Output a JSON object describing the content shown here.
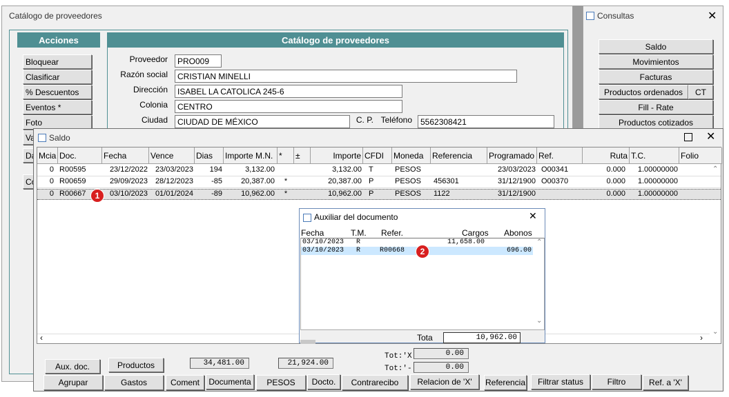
{
  "catalog": {
    "window_title": "Catálogo de proveedores",
    "acciones_header": "Acciones",
    "panel_header": "Catálogo de proveedores",
    "actions": [
      "Bloquear",
      "Clasificar",
      "% Descuentos",
      "Eventos *",
      "Foto",
      "Va",
      "Da",
      "Co"
    ],
    "fields": {
      "proveedor_label": "Proveedor",
      "proveedor": "PRO009",
      "razon_label": "Razón social",
      "razon": "CRISTIAN MINELLI",
      "direccion_label": "Dirección",
      "direccion": "ISABEL LA CATOLICA 245-6",
      "colonia_label": "Colonia",
      "colonia": "CENTRO",
      "ciudad_label": "Ciudad",
      "ciudad": "CIUDAD DE MÉXICO",
      "cp_label": "C. P.",
      "telefono_label": "Teléfono",
      "telefono": "5562308421"
    }
  },
  "consultas": {
    "title": "Consultas",
    "buttons": [
      "Saldo",
      "Movimientos",
      "Facturas",
      "Productos ordenados",
      "CT",
      "Fill - Rate",
      "Productos cotizados"
    ]
  },
  "saldo": {
    "title": "Saldo",
    "columns": [
      "Mcia",
      "Doc.",
      "Fecha",
      "Vence",
      "Dias",
      "Importe M.N.",
      "*",
      "±",
      "Importe",
      "CFDI",
      "Moneda",
      "Referencia",
      "Programado",
      "Ref.",
      "Ruta",
      "T.C.",
      "Folio"
    ],
    "rows": [
      [
        "0",
        "R00595",
        "23/12/2022",
        "23/03/2023",
        "194",
        "3,132.00",
        "",
        "",
        "3,132.00",
        "T",
        "PESOS",
        "",
        "23/03/2023",
        "O00341",
        "0.000",
        "1.00000000",
        ""
      ],
      [
        "0",
        "R00659",
        "29/09/2023",
        "28/12/2023",
        "-85",
        "20,387.00",
        "*",
        "",
        "20,387.00",
        "P",
        "PESOS",
        "456301",
        "31/12/1900",
        "O00370",
        "0.000",
        "1.00000000",
        ""
      ],
      [
        "0",
        "R00667",
        "03/10/2023",
        "01/01/2024",
        "-89",
        "10,962.00",
        "*",
        "",
        "10,962.00",
        "P",
        "PESOS",
        "1122",
        "31/12/1900",
        "",
        "0.000",
        "1.00000000",
        ""
      ]
    ],
    "badge1": "1",
    "totals": {
      "left": "34,481.00",
      "right": "21,924.00",
      "tot_x_label": "Tot:'X",
      "tot_x": "0.00",
      "tot_minus_label": "Tot:'-",
      "tot_minus": "0.00"
    },
    "bottom_row1": [
      "Aux. doc.",
      "Productos"
    ],
    "bottom_row2": [
      "Agrupar",
      "Gastos",
      "Coment",
      "Documenta",
      "PESOS",
      "Docto.",
      "Contrarecibo",
      "Relacion de 'X'",
      "Referencia",
      "Filtrar status",
      "Filtro",
      "Ref. a 'X'"
    ]
  },
  "auxiliar": {
    "title": "Auxiliar del documento",
    "columns": [
      "Fecha",
      "T.M.",
      "Refer.",
      "Cargos",
      "Abonos"
    ],
    "rows": [
      [
        "03/10/2023",
        "R",
        "",
        "11,658.00",
        ""
      ],
      [
        "03/10/2023",
        "R",
        "R00668",
        "",
        "696.00"
      ]
    ],
    "badge2": "2",
    "total_label": "Tota",
    "total": "10,962.00"
  },
  "colors": {
    "teal": "#4f8f93",
    "badge": "#d81f1f",
    "selection": "#cce8ff"
  }
}
